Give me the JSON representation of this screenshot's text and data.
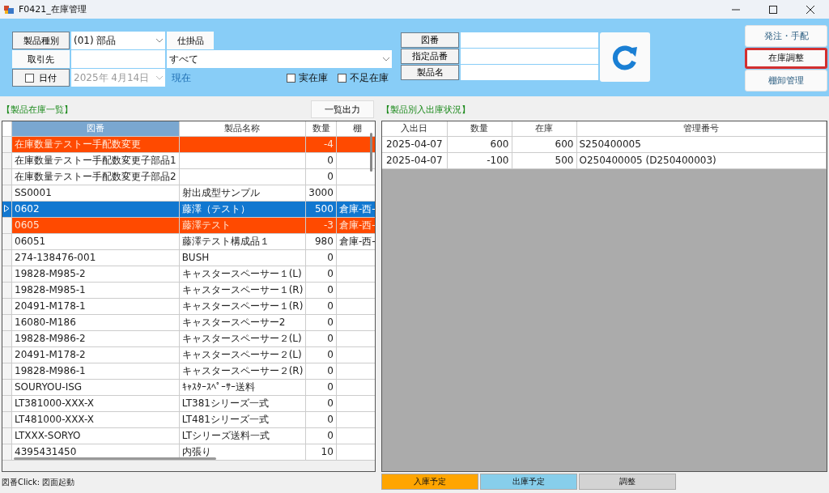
{
  "window": {
    "title": "F0421_在庫管理"
  },
  "filters": {
    "product_type_button": "製品種別",
    "product_type_value": "(01) 部品",
    "wip_button": "仕掛品",
    "supplier_button": "取引先",
    "supplier_scope": "すべて",
    "date_toggle": {
      "label": "日付",
      "checked": false
    },
    "date_value": "2025年  4月14日",
    "current_label": "現在",
    "actual_stock": {
      "label": "実在庫",
      "checked": false
    },
    "shortage_stock": {
      "label": "不足在庫",
      "checked": false
    }
  },
  "search": {
    "fields": [
      {
        "label": "図番"
      },
      {
        "label": "指定品番"
      },
      {
        "label": "製品名"
      }
    ]
  },
  "actions": [
    {
      "label": "発注・手配",
      "highlighted": false
    },
    {
      "label": "在庫調整",
      "highlighted": true
    },
    {
      "label": "棚卸管理",
      "highlighted": false
    }
  ],
  "stock_list": {
    "title": "【製品在庫一覧】",
    "export_button": "一覧出力",
    "columns": [
      "図番",
      "製品名称",
      "数量",
      "棚"
    ],
    "rows": [
      {
        "cells": [
          "在庫数量テストー手配数変更",
          "",
          "-4",
          ""
        ],
        "shortage": true,
        "selected": false
      },
      {
        "cells": [
          "在庫数量テストー手配数変更子部品1",
          "",
          "0",
          ""
        ],
        "shortage": false,
        "selected": false
      },
      {
        "cells": [
          "在庫数量テストー手配数変更子部品2",
          "",
          "0",
          ""
        ],
        "shortage": false,
        "selected": false
      },
      {
        "cells": [
          "SS0001",
          "射出成型サンプル",
          "3000",
          ""
        ],
        "shortage": false,
        "selected": false
      },
      {
        "cells": [
          "0602",
          "藤澤（テスト）",
          "500",
          "倉庫-西-"
        ],
        "shortage": false,
        "selected": true
      },
      {
        "cells": [
          "0605",
          "藤澤テスト",
          "-3",
          "倉庫-西-"
        ],
        "shortage": true,
        "selected": false
      },
      {
        "cells": [
          "06051",
          "藤澤テスト構成品１",
          "980",
          "倉庫-西-"
        ],
        "shortage": false,
        "selected": false
      },
      {
        "cells": [
          "274-138476-001",
          "BUSH",
          "0",
          ""
        ],
        "shortage": false,
        "selected": false
      },
      {
        "cells": [
          "19828-M985-2",
          "キャスタースペーサー１(L)",
          "0",
          ""
        ],
        "shortage": false,
        "selected": false
      },
      {
        "cells": [
          "19828-M985-1",
          "キャスタースペーサー１(R)",
          "0",
          ""
        ],
        "shortage": false,
        "selected": false
      },
      {
        "cells": [
          "20491-M178-1",
          "キャスタースペーサー１(R)",
          "0",
          ""
        ],
        "shortage": false,
        "selected": false
      },
      {
        "cells": [
          "16080-M186",
          "キャスタースペーサー2",
          "0",
          ""
        ],
        "shortage": false,
        "selected": false
      },
      {
        "cells": [
          "19828-M986-2",
          "キャスタースペーサー２(L)",
          "0",
          ""
        ],
        "shortage": false,
        "selected": false
      },
      {
        "cells": [
          "20491-M178-2",
          "キャスタースペーサー２(L)",
          "0",
          ""
        ],
        "shortage": false,
        "selected": false
      },
      {
        "cells": [
          "19828-M986-1",
          "キャスタースペーサー２(R)",
          "0",
          ""
        ],
        "shortage": false,
        "selected": false
      },
      {
        "cells": [
          "SOURYOU-ISG",
          "ｷｬｽﾀｰｽﾍﾟｰｻｰ送料",
          "0",
          ""
        ],
        "shortage": false,
        "selected": false
      },
      {
        "cells": [
          "LT381000-XXX-X",
          "LT381シリーズ一式",
          "0",
          ""
        ],
        "shortage": false,
        "selected": false
      },
      {
        "cells": [
          "LT481000-XXX-X",
          "LT481シリーズ一式",
          "0",
          ""
        ],
        "shortage": false,
        "selected": false
      },
      {
        "cells": [
          "LTXXX-SORYO",
          "LTシリーズ送料一式",
          "0",
          ""
        ],
        "shortage": false,
        "selected": false
      },
      {
        "cells": [
          "4395431450",
          "内張り",
          "10",
          ""
        ],
        "shortage": false,
        "selected": false
      }
    ],
    "hint": "図番Click: 図面起動"
  },
  "movements": {
    "title": "【製品別入出庫状況】",
    "columns": [
      "入出日",
      "数量",
      "在庫",
      "管理番号"
    ],
    "rows": [
      {
        "cells": [
          "2025-04-07",
          "600",
          "600",
          "S250400005"
        ]
      },
      {
        "cells": [
          "2025-04-07",
          "-100",
          "500",
          "O250400005 (D250400003)"
        ]
      }
    ]
  },
  "legend": [
    {
      "label": "入庫予定",
      "color": "#ffa500"
    },
    {
      "label": "出庫予定",
      "color": "#87ceeb"
    },
    {
      "label": "調整",
      "color": "#d3d3d3"
    }
  ]
}
